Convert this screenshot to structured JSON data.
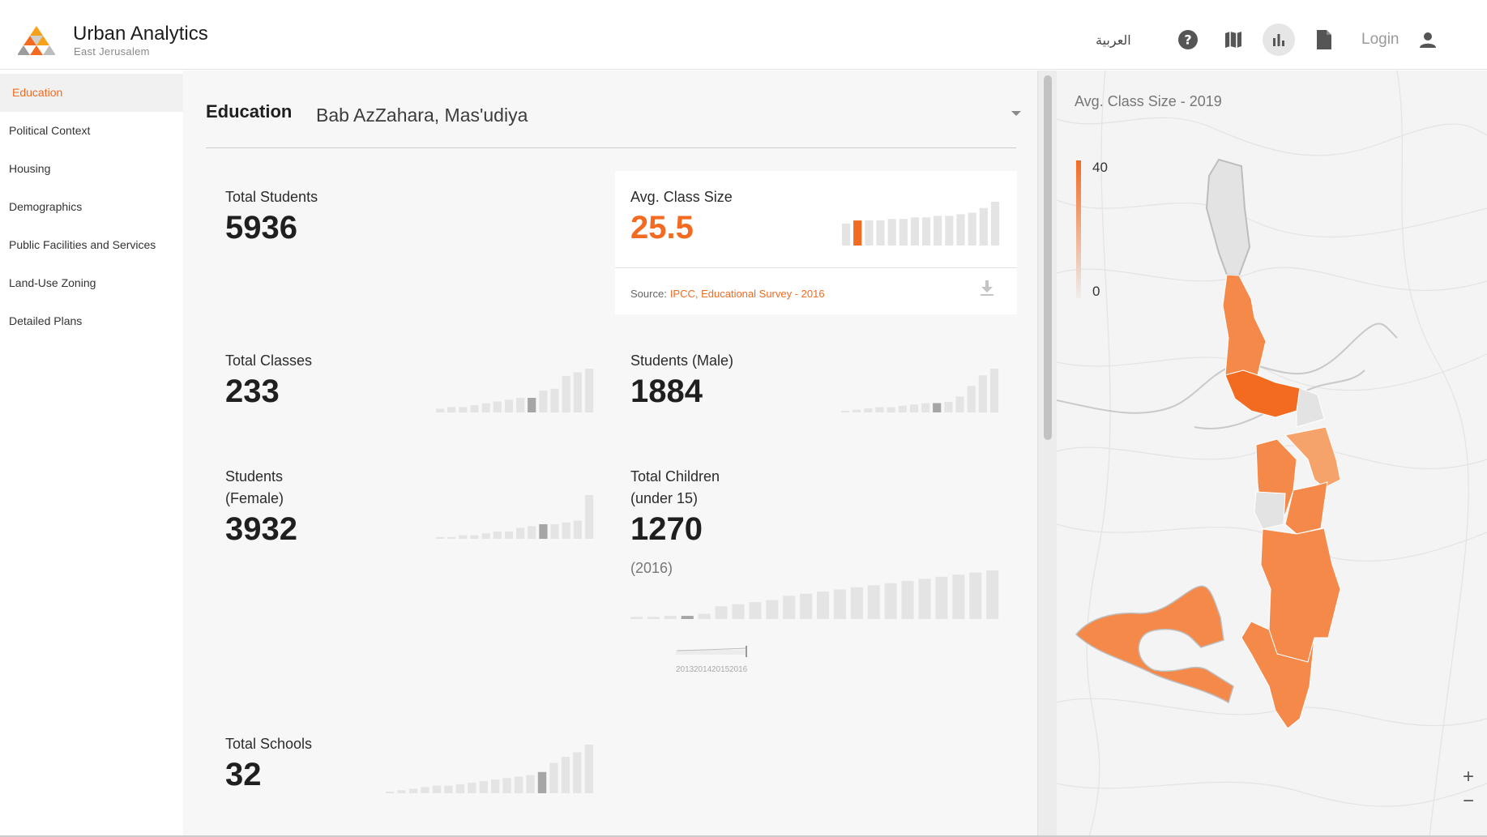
{
  "header": {
    "title": "Urban Analytics",
    "subtitle": "East Jerusalem",
    "language": "العربية",
    "login": "Login",
    "icons": [
      "help-icon",
      "map-icon",
      "bar-chart-icon",
      "document-icon",
      "user-icon"
    ]
  },
  "sidebar": {
    "items": [
      {
        "label": "Education",
        "active": true
      },
      {
        "label": "Political Context"
      },
      {
        "label": "Housing"
      },
      {
        "label": "Demographics"
      },
      {
        "label": "Public Facilities and Services"
      },
      {
        "label": "Land-Use Zoning"
      },
      {
        "label": "Detailed Plans"
      }
    ]
  },
  "main": {
    "title": "Education",
    "region": "Bab AzZahara, Mas'udiya",
    "stats": {
      "total_students": {
        "label": "Total Students",
        "value": "5936"
      },
      "avg_class_size": {
        "label": "Avg. Class Size",
        "value": "25.5",
        "source_prefix": "Source:",
        "source_link": "IPCC, Educational Survey - 2016",
        "bars": [
          14,
          16,
          16,
          16,
          17,
          17,
          18,
          18,
          19,
          19,
          20,
          21,
          24,
          28
        ],
        "highlight": 1
      },
      "total_classes": {
        "label": "Total Classes",
        "value": "233",
        "bars": [
          2,
          3,
          3,
          4,
          5,
          6,
          7,
          8,
          8,
          12,
          13,
          20,
          22,
          24
        ],
        "highlight": 8
      },
      "students_male": {
        "label": "Students (Male)",
        "value": "1884",
        "bars": [
          1,
          2,
          3,
          4,
          4,
          5,
          6,
          7,
          7,
          8,
          12,
          20,
          28,
          33
        ],
        "highlight": 8
      },
      "students_female": {
        "label": "Students",
        "label2": "(Female)",
        "value": "3932",
        "bars": [
          1,
          1,
          2,
          2,
          3,
          4,
          4,
          6,
          7,
          8,
          8,
          9,
          10,
          24
        ],
        "highlight": 9
      },
      "total_children": {
        "label": "Total Children",
        "label2": "(under 15)",
        "value": "1270",
        "year": "(2016)",
        "bars": [
          2,
          2,
          3,
          3,
          5,
          12,
          14,
          16,
          18,
          22,
          24,
          26,
          28,
          30,
          32,
          34,
          36,
          38,
          40,
          42,
          44,
          46
        ],
        "highlight": 3,
        "mini_axis": [
          "2013",
          "2014",
          "2015",
          "2016"
        ]
      },
      "total_schools": {
        "label": "Total Schools",
        "value": "32",
        "bars": [
          1,
          2,
          3,
          4,
          5,
          5,
          6,
          7,
          8,
          9,
          10,
          11,
          12,
          14,
          20,
          24,
          27,
          32
        ],
        "highlight": 13
      }
    }
  },
  "map": {
    "title": "Avg. Class Size - 2019",
    "legend_max": "40",
    "legend_min": "0",
    "zoom_in": "+",
    "zoom_out": "−",
    "accent": "#f26b21",
    "mid": "#f4894a",
    "light": "#f6a36b",
    "none": "#e3e3e3"
  },
  "colors": {
    "accent": "#f26b21",
    "bar": "#e4e4e4",
    "bar_highlight": "#a6a6a6"
  }
}
